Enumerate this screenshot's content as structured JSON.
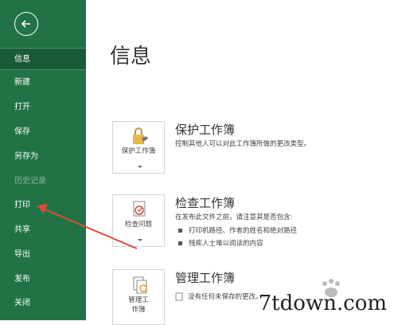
{
  "sidebar": {
    "bg_color": "#217346",
    "items": [
      {
        "label": "信息",
        "active": true
      },
      {
        "label": "新建"
      },
      {
        "label": "打开"
      },
      {
        "label": "保存"
      },
      {
        "label": "另存为"
      },
      {
        "label": "历史记录",
        "disabled": true
      },
      {
        "label": "打印"
      },
      {
        "label": "共享"
      },
      {
        "label": "导出"
      },
      {
        "label": "发布"
      },
      {
        "label": "关闭"
      }
    ]
  },
  "main": {
    "title": "信息",
    "sections": [
      {
        "card_label": "保护工作簿",
        "title": "保护工作簿",
        "desc": "控制其他人可以对此工作簿所做的更改类型。",
        "icon": "lock-icon"
      },
      {
        "card_label": "检查问题",
        "title": "检查工作簿",
        "desc": "在发布此文件之前，请注意其是否包含:",
        "bullets": [
          "打印机路径、作者的姓名和绝对路径",
          "残疾人士难以阅读的内容"
        ],
        "icon": "inspect-icon"
      },
      {
        "card_label_1": "管理工",
        "card_label_2": "作簿",
        "title": "管理工作簿",
        "desc": "没有任何未保存的更改。",
        "icon": "manage-icon"
      }
    ]
  },
  "watermark": "7tdown.com",
  "accent_arrow_color": "#e04b3a"
}
